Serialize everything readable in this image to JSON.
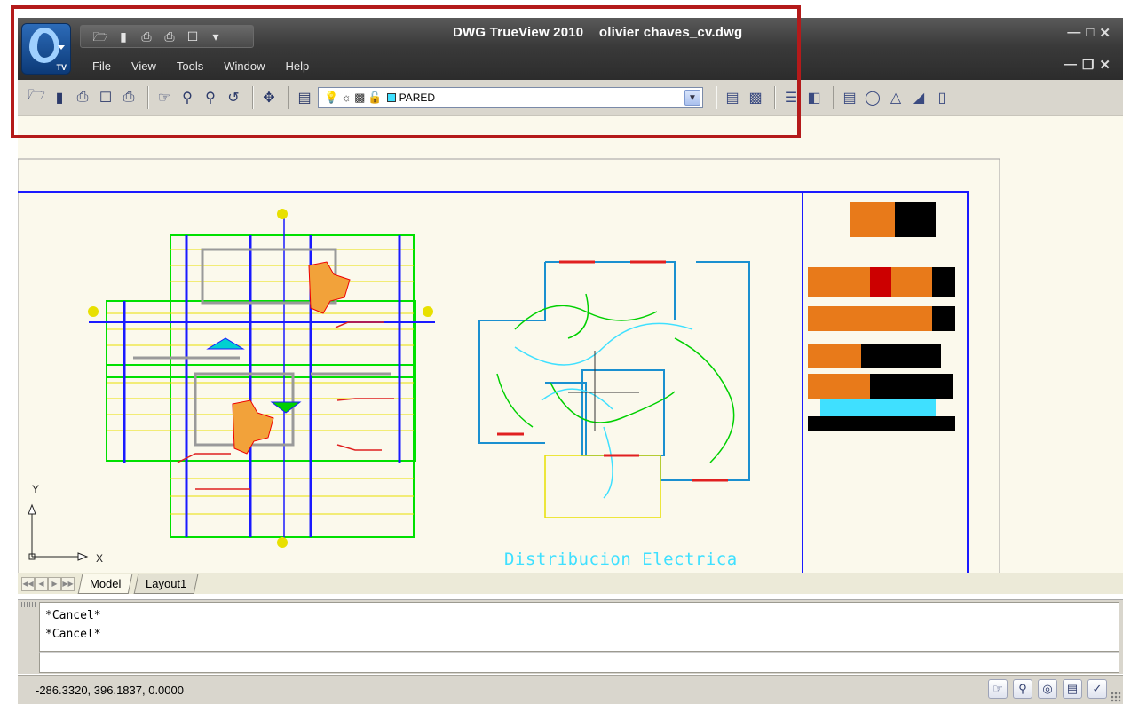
{
  "window": {
    "app_name": "DWG TrueView 2010",
    "file_name": "olivier chaves_cv.dwg",
    "logo_badge": "TV"
  },
  "menu": {
    "items": [
      "File",
      "View",
      "Tools",
      "Window",
      "Help"
    ]
  },
  "toolbar": {
    "layer_value": "PARED",
    "layer_swatch_color": "#3fe0ff"
  },
  "drawing": {
    "title_label": "Distribucion  Electrica",
    "ucs_y": "Y",
    "ucs_x": "X"
  },
  "tabs": {
    "model": "Model",
    "layout1": "Layout1"
  },
  "command": {
    "history": [
      "*Cancel*",
      "*Cancel*"
    ],
    "input": ""
  },
  "status": {
    "coordinates": "-286.3320, 396.1837, 0.0000"
  },
  "colors": {
    "highlight": "#b41a1a",
    "drawing_bg": "#fbf9ec",
    "titlebar": "#3a3a3a"
  }
}
